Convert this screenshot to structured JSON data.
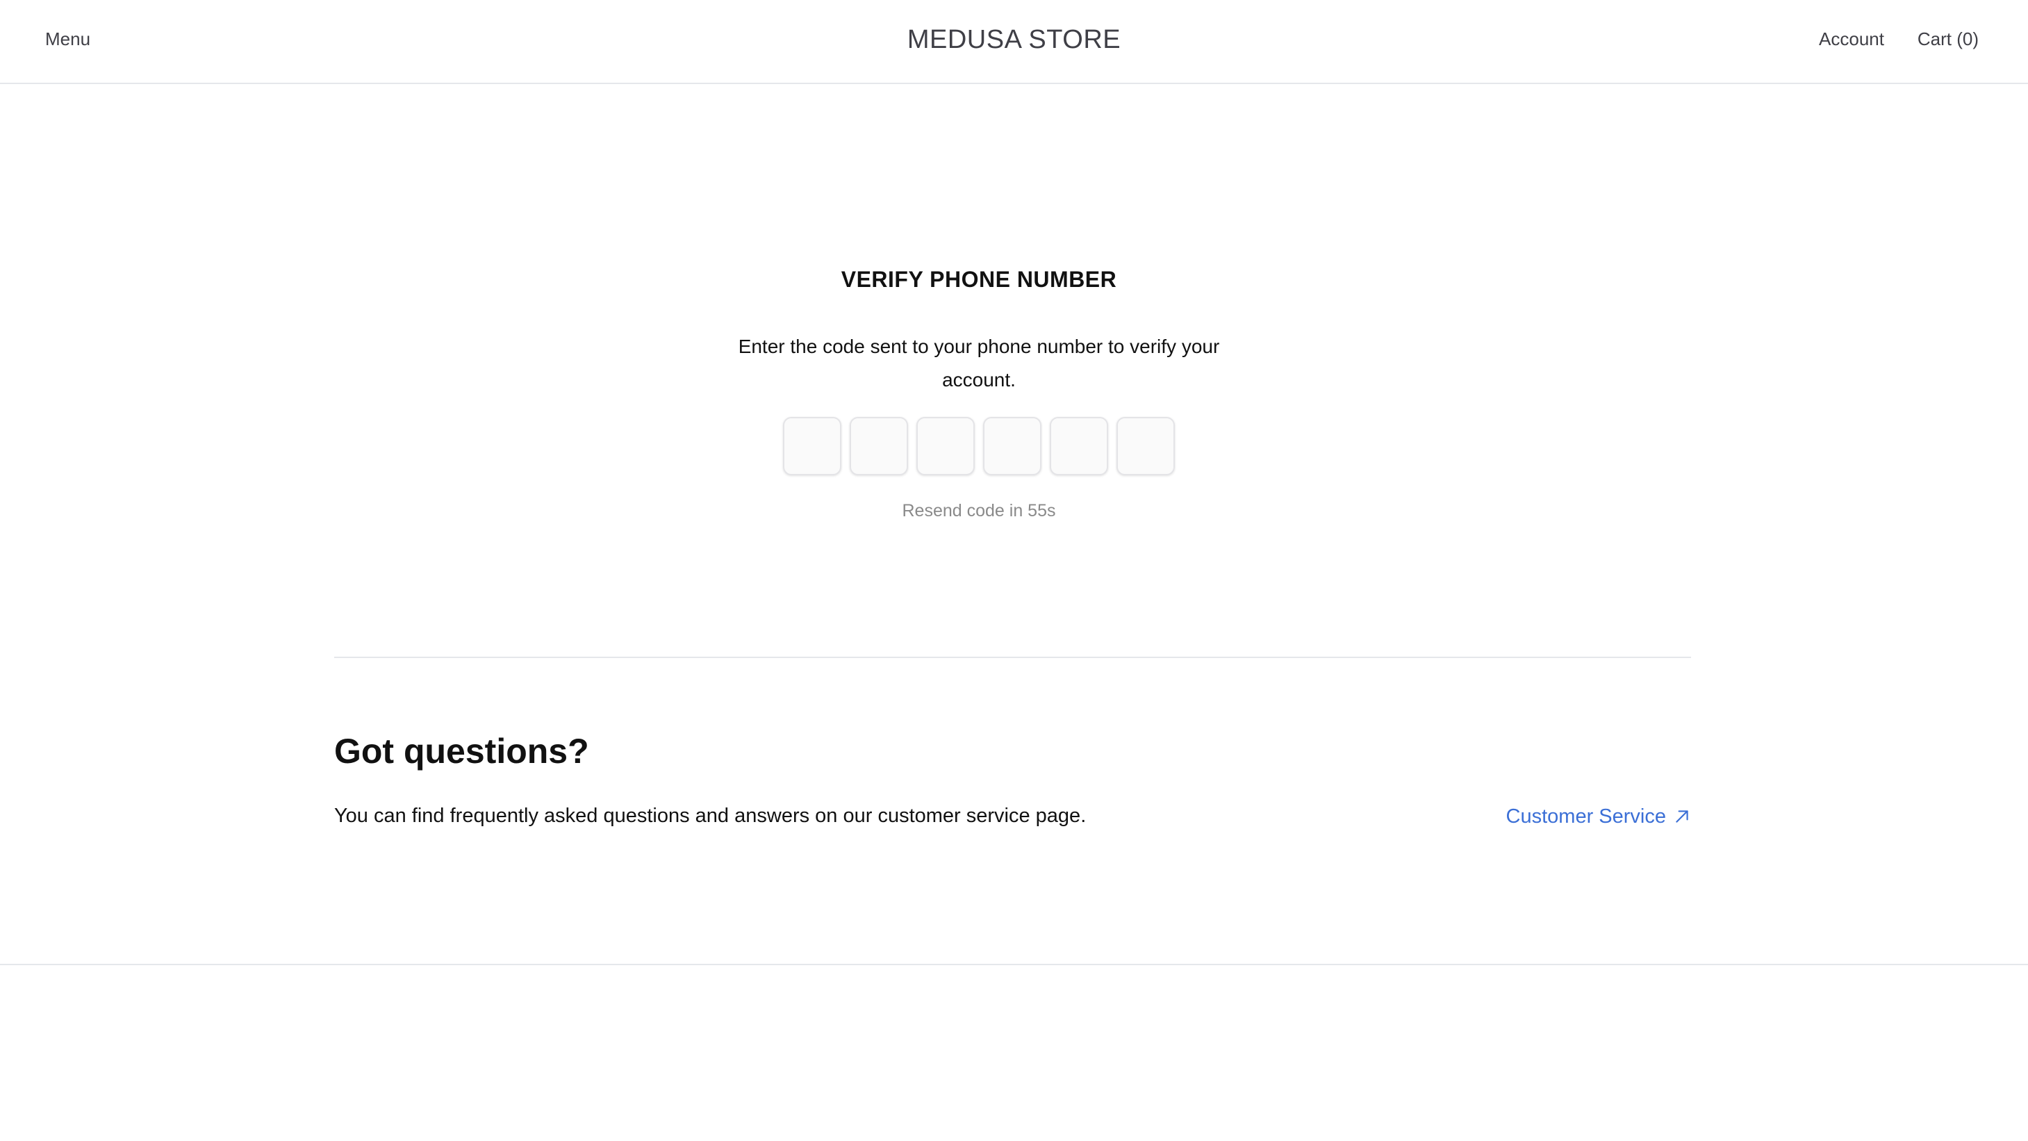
{
  "header": {
    "menu_label": "Menu",
    "store_title": "MEDUSA STORE",
    "account_label": "Account",
    "cart_label": "Cart (0)"
  },
  "verify": {
    "title": "VERIFY PHONE NUMBER",
    "description": "Enter the code sent to your phone number to verify your account.",
    "code_digits": [
      "",
      "",
      "",
      "",
      "",
      ""
    ],
    "resend_text": "Resend code in 55s"
  },
  "help": {
    "title": "Got questions?",
    "text": "You can find frequently asked questions and answers on our customer service page.",
    "link_label": "Customer Service",
    "link_icon": "arrow-up-right-icon"
  },
  "colors": {
    "link": "#3b6fd6",
    "muted": "#8a8a8a",
    "border": "#e5e7eb"
  }
}
